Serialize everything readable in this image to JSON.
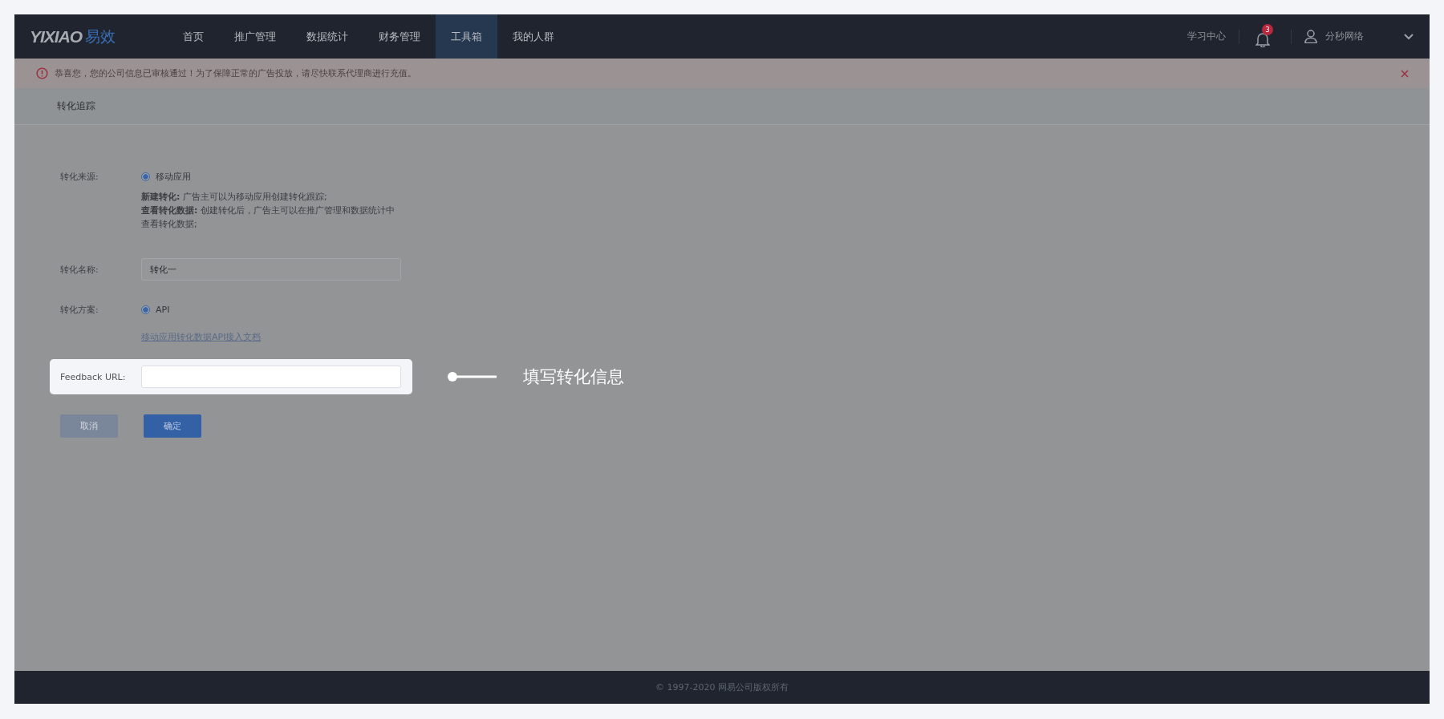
{
  "header": {
    "logo_latin": "YIXIAO",
    "logo_cn": "易效",
    "nav": [
      {
        "label": "首页",
        "selected": false
      },
      {
        "label": "推广管理",
        "selected": false
      },
      {
        "label": "数据统计",
        "selected": false
      },
      {
        "label": "财务管理",
        "selected": false
      },
      {
        "label": "工具箱",
        "selected": true
      },
      {
        "label": "我的人群",
        "selected": false
      }
    ],
    "learning_center": "学习中心",
    "notification_count": "3",
    "user": "分秒网络"
  },
  "alert": {
    "message": "恭喜您，您的公司信息已审核通过！为了保障正常的广告投放，请尽快联系代理商进行充值。"
  },
  "page_title": "转化追踪",
  "form": {
    "source_label": "转化来源:",
    "source_options": [
      {
        "label": "移动应用",
        "selected": true
      }
    ],
    "description": [
      "**新建转化:** 广告主可以为移动应用创建转化跟踪;",
      "**查看转化数据:** 创建转化后，广告主可以在推广管理和数据统计中查看转化数据;"
    ],
    "name_label": "转化名称:",
    "name_value": "转化一",
    "plan_label": "转化方案:",
    "plan_options": [
      {
        "label": "API",
        "selected": true
      }
    ],
    "doc_link": "移动应用转化数据API接入文档",
    "feedback_label": "Feedback URL:",
    "buttons": [
      {
        "label": "取消",
        "disabled": true
      },
      {
        "label": "确定",
        "disabled": false
      }
    ]
  },
  "annotation": "填写转化信息",
  "footer": "© 1997-2020 网易公司版权所有"
}
